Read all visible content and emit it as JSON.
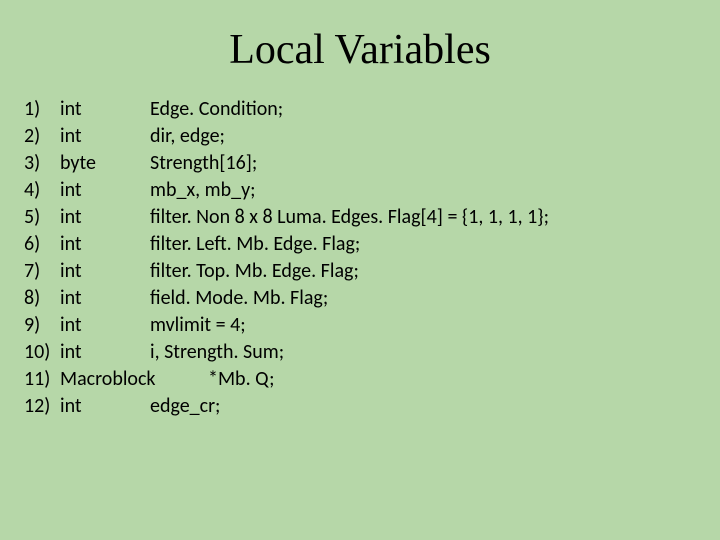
{
  "title": "Local Variables",
  "rows": [
    {
      "n": "1)",
      "type": "int",
      "val": "Edge. Condition;"
    },
    {
      "n": "2)",
      "type": "int",
      "val": "dir, edge;"
    },
    {
      "n": "3)",
      "type": "byte",
      "val": "Strength[16];"
    },
    {
      "n": "4)",
      "type": "int",
      "val": "mb_x, mb_y;"
    },
    {
      "n": "5)",
      "type": "int",
      "val": "filter. Non 8 x 8 Luma. Edges. Flag[4] = {1, 1, 1, 1};"
    },
    {
      "n": "6)",
      "type": "int",
      "val": "filter. Left. Mb. Edge. Flag;"
    },
    {
      "n": "7)",
      "type": "int",
      "val": "filter. Top. Mb. Edge. Flag;"
    },
    {
      "n": "8)",
      "type": "int",
      "val": "field. Mode. Mb. Flag;"
    },
    {
      "n": "9)",
      "type": "int",
      "val": "mvlimit = 4;"
    },
    {
      "n": "10)",
      "type": "int",
      "val": "i, Strength. Sum;"
    },
    {
      "n": "11)",
      "type": "Macroblock",
      "val": "*Mb. Q;",
      "wide": true
    },
    {
      "n": "12)",
      "type": "int",
      "val": "edge_cr;"
    }
  ]
}
